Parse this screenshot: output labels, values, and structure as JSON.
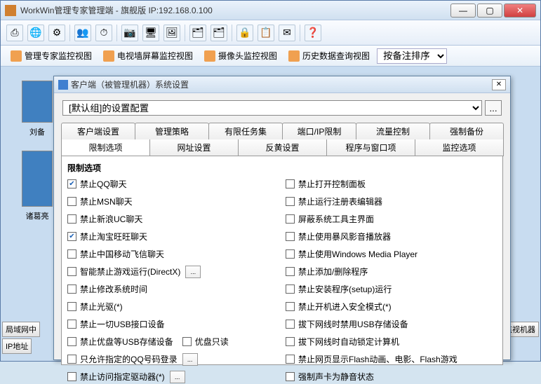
{
  "window": {
    "title": "WorkWin管理专家管理端 - 旗舰版 IP:192.168.0.100"
  },
  "views": {
    "v1": "管理专家监控视图",
    "v2": "电视墙屏幕监控视图",
    "v3": "摄像头监控视图",
    "v4": "历史数据查询视图",
    "sort": "按备注排序"
  },
  "thumbs": {
    "t1": "刘备",
    "t2": "诸葛亮"
  },
  "side": {
    "lan": "局域网中",
    "ip": "IP地址",
    "mon": "监视机器"
  },
  "dialog": {
    "title": "客户端（被管理机器）系统设置",
    "config": "[默认组]的设置配置",
    "tabs1": {
      "a": "客户端设置",
      "b": "管理策略",
      "c": "有限任务集",
      "d": "端口/IP限制",
      "e": "流量控制",
      "f": "强制备份"
    },
    "tabs2": {
      "a": "限制选项",
      "b": "网址设置",
      "c": "反黄设置",
      "d": "程序与窗口项",
      "e": "监控选项"
    },
    "group_title": "限制选项",
    "left": [
      {
        "label": "禁止QQ聊天",
        "checked": true
      },
      {
        "label": "禁止MSN聊天",
        "checked": false
      },
      {
        "label": "禁止新浪UC聊天",
        "checked": false
      },
      {
        "label": "禁止淘宝旺旺聊天",
        "checked": true
      },
      {
        "label": "禁止中国移动飞信聊天",
        "checked": false
      },
      {
        "label": "智能禁止游戏运行(DirectX)",
        "checked": false,
        "btn": true
      },
      {
        "label": "禁止修改系统时间",
        "checked": false
      },
      {
        "label": "禁止光驱(*)",
        "checked": false
      },
      {
        "label": "禁止一切USB接口设备",
        "checked": false
      },
      {
        "label": "禁止优盘等USB存储设备",
        "checked": false,
        "extra": true
      },
      {
        "label": "只允许指定的QQ号码登录",
        "checked": false,
        "btn": true
      },
      {
        "label": "禁止访问指定驱动器(*)",
        "checked": false,
        "btn": true
      }
    ],
    "extra_chk": "优盘只读",
    "right": [
      {
        "label": "禁止打开控制面板",
        "checked": false
      },
      {
        "label": "禁止运行注册表编辑器",
        "checked": false
      },
      {
        "label": "屏蔽系统工具主界面",
        "checked": false
      },
      {
        "label": "禁止使用暴风影音播放器",
        "checked": false
      },
      {
        "label": "禁止使用Windows Media Player",
        "checked": false
      },
      {
        "label": "禁止添加/删除程序",
        "checked": false
      },
      {
        "label": "禁止安装程序(setup)运行",
        "checked": false
      },
      {
        "label": "禁止开机进入安全模式(*)",
        "checked": false
      },
      {
        "label": "拔下网线时禁用USB存储设备",
        "checked": false
      },
      {
        "label": "拔下网线时自动锁定计算机",
        "checked": false
      },
      {
        "label": "禁止网页显示Flash动画、电影、Flash游戏",
        "checked": false
      },
      {
        "label": "强制声卡为静音状态",
        "checked": false
      }
    ]
  }
}
